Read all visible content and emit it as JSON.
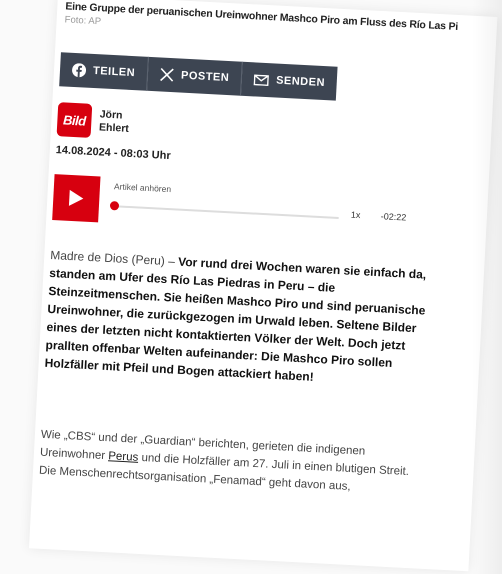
{
  "image": {
    "caption": "Eine Gruppe der peruanischen Ureinwohner Mashco Piro am Fluss des Río Las Pi",
    "credit": "Foto: AP"
  },
  "share": {
    "facebook_label": "TEILEN",
    "x_label": "POSTEN",
    "mail_label": "SENDEN"
  },
  "author": {
    "logo_text": "Bild",
    "first_name": "Jörn",
    "last_name": "Ehlert"
  },
  "date": "14.08.2024 - 08:03 Uhr",
  "audio": {
    "label": "Artikel anhören",
    "speed": "1x",
    "remaining": "-02:22"
  },
  "lead": {
    "location": "Madre de Dios (Peru) –",
    "text": "Vor rund drei Wochen waren sie einfach da, standen am Ufer des Río Las Piedras in Peru – die Steinzeitmenschen. Sie heißen Mashco Piro und sind peruanische Ureinwohner, die zurückgezogen im Urwald leben. Seltene Bilder eines der letzten nicht kontaktierten Völker der Welt. Doch jetzt prallten offenbar Welten aufeinander: Die Mashco Piro sollen Holzfäller mit Pfeil und Bogen attackiert haben!"
  },
  "body": {
    "part1": "Wie „CBS“ und der „Guardian“ berichten, gerieten die indigenen Ureinwohner",
    "link": "Perus",
    "part2": "und die Holzfäller am 27. Juli in einen blutigen Streit. Die Menschenrechtsorganisation „Fenamad“ geht davon aus,"
  }
}
